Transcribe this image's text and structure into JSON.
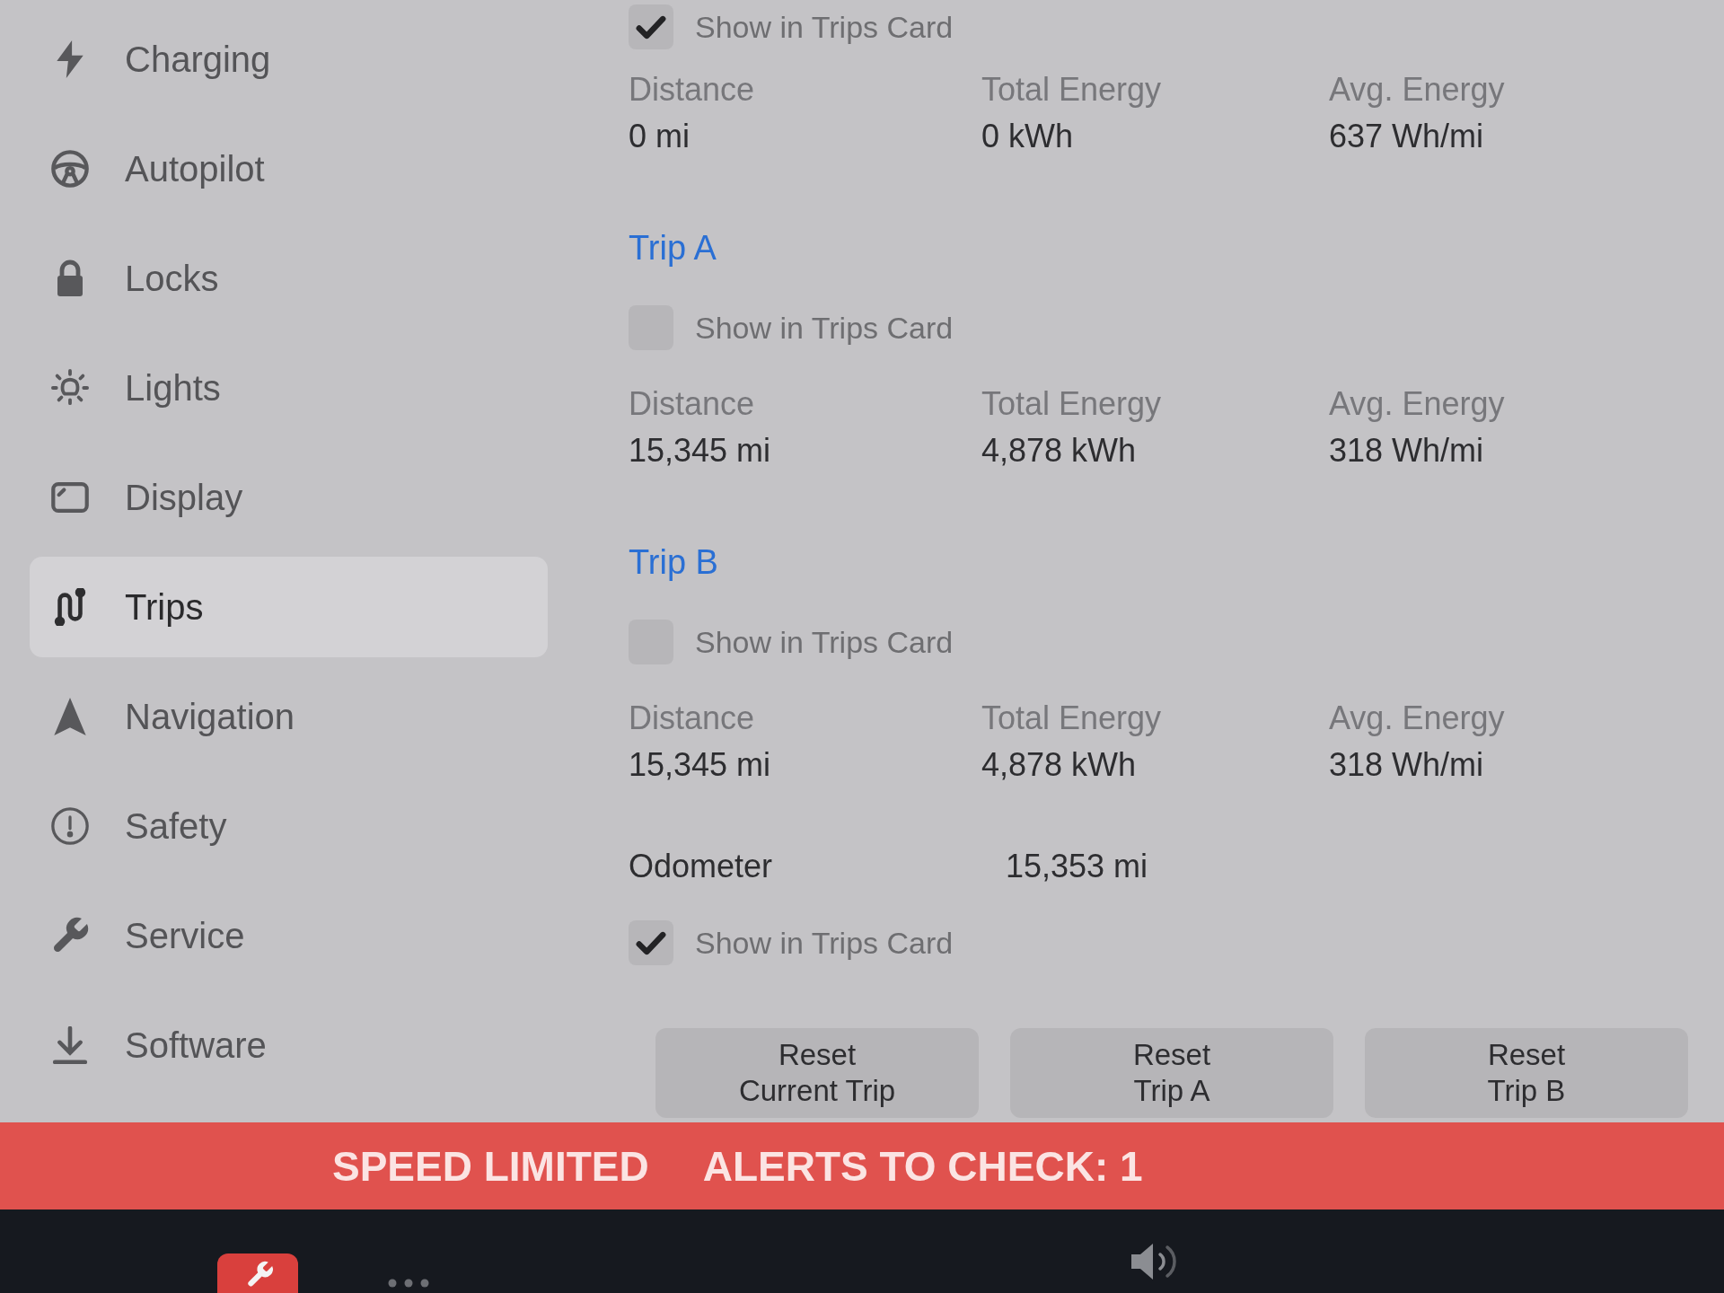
{
  "sidebar": {
    "items": [
      {
        "label": "Charging",
        "selected": false
      },
      {
        "label": "Autopilot",
        "selected": false
      },
      {
        "label": "Locks",
        "selected": false
      },
      {
        "label": "Lights",
        "selected": false
      },
      {
        "label": "Display",
        "selected": false
      },
      {
        "label": "Trips",
        "selected": true
      },
      {
        "label": "Navigation",
        "selected": false
      },
      {
        "label": "Safety",
        "selected": false
      },
      {
        "label": "Service",
        "selected": false
      },
      {
        "label": "Software",
        "selected": false
      }
    ]
  },
  "sections": [
    {
      "checkbox": {
        "label": "Show in Trips Card",
        "checked": true
      },
      "stats": [
        {
          "label": "Distance",
          "value": "0 mi"
        },
        {
          "label": "Total Energy",
          "value": "0 kWh"
        },
        {
          "label": "Avg. Energy",
          "value": "637 Wh/mi"
        }
      ]
    },
    {
      "heading": "Trip A",
      "checkbox": {
        "label": "Show in Trips Card",
        "checked": false
      },
      "stats": [
        {
          "label": "Distance",
          "value": "15,345 mi"
        },
        {
          "label": "Total Energy",
          "value": "4,878 kWh"
        },
        {
          "label": "Avg. Energy",
          "value": "318 Wh/mi"
        }
      ]
    },
    {
      "heading": "Trip B",
      "checkbox": {
        "label": "Show in Trips Card",
        "checked": false
      },
      "stats": [
        {
          "label": "Distance",
          "value": "15,345 mi"
        },
        {
          "label": "Total Energy",
          "value": "4,878 kWh"
        },
        {
          "label": "Avg. Energy",
          "value": "318 Wh/mi"
        }
      ]
    }
  ],
  "odometer": {
    "label": "Odometer",
    "value": "15,353 mi",
    "checkbox": {
      "label": "Show in Trips Card",
      "checked": true
    }
  },
  "buttons": [
    "Reset\nCurrent Trip",
    "Reset\nTrip A",
    "Reset\nTrip B"
  ],
  "alert_banner": {
    "status": "SPEED LIMITED",
    "alerts": "ALERTS TO CHECK: 1"
  }
}
